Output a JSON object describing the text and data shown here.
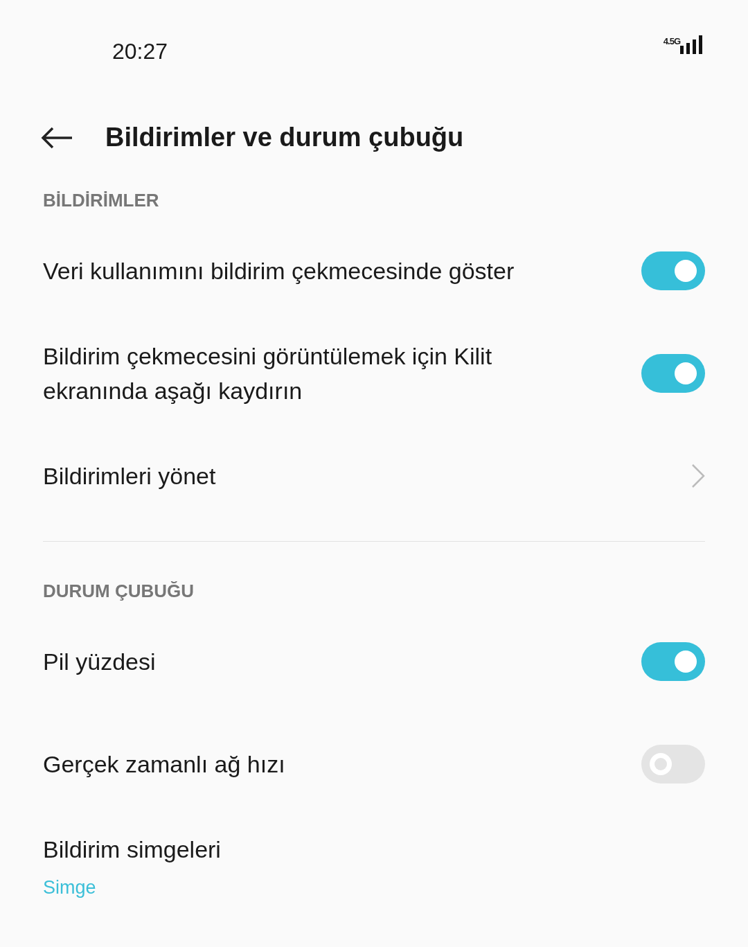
{
  "status_bar": {
    "time": "20:27",
    "network": "4.5G"
  },
  "header": {
    "title": "Bildirimler ve durum çubuğu"
  },
  "sections": [
    {
      "title": "BİLDİRİMLER",
      "items": [
        {
          "kind": "toggle",
          "label": "Veri kullanımını bildirim çekmecesinde göster",
          "on": true
        },
        {
          "kind": "toggle",
          "label": "Bildirim çekmecesini görüntülemek için Kilit ekranında aşağı kaydırın",
          "on": true
        },
        {
          "kind": "link",
          "label": "Bildirimleri yönet"
        }
      ]
    },
    {
      "title": "DURUM ÇUBUĞU",
      "items": [
        {
          "kind": "toggle",
          "label": "Pil yüzdesi",
          "on": true
        },
        {
          "kind": "toggle",
          "label": "Gerçek zamanlı ağ hızı",
          "on": false
        },
        {
          "kind": "value",
          "label": "Bildirim simgeleri",
          "value": "Simge"
        }
      ]
    }
  ]
}
